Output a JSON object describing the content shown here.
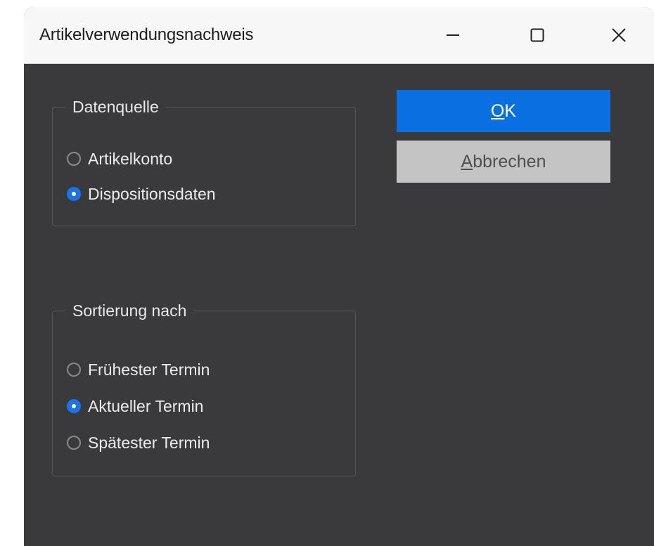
{
  "window": {
    "title": "Artikelverwendungsnachweis",
    "controls": {
      "minimize_icon": "minimize-icon",
      "maximize_icon": "maximize-icon",
      "close_icon": "close-icon"
    }
  },
  "datenquelle": {
    "legend": "Datenquelle",
    "options": [
      {
        "label": "Artikelkonto",
        "checked": false
      },
      {
        "label": "Dispositionsdaten",
        "checked": true
      }
    ]
  },
  "sortierung": {
    "legend": "Sortierung nach",
    "options": [
      {
        "label": "Frühester Termin",
        "checked": false
      },
      {
        "label": "Aktueller Termin",
        "checked": true
      },
      {
        "label": "Spätester Termin",
        "checked": false
      }
    ]
  },
  "buttons": {
    "ok_label": "OK",
    "cancel_label": "Abbrechen"
  },
  "colors": {
    "window_bg": "#3a3a3d",
    "titlebar_bg": "#f7f7f7",
    "accent": "#0a6fe0",
    "cancel_bg": "#c4c4c4"
  }
}
